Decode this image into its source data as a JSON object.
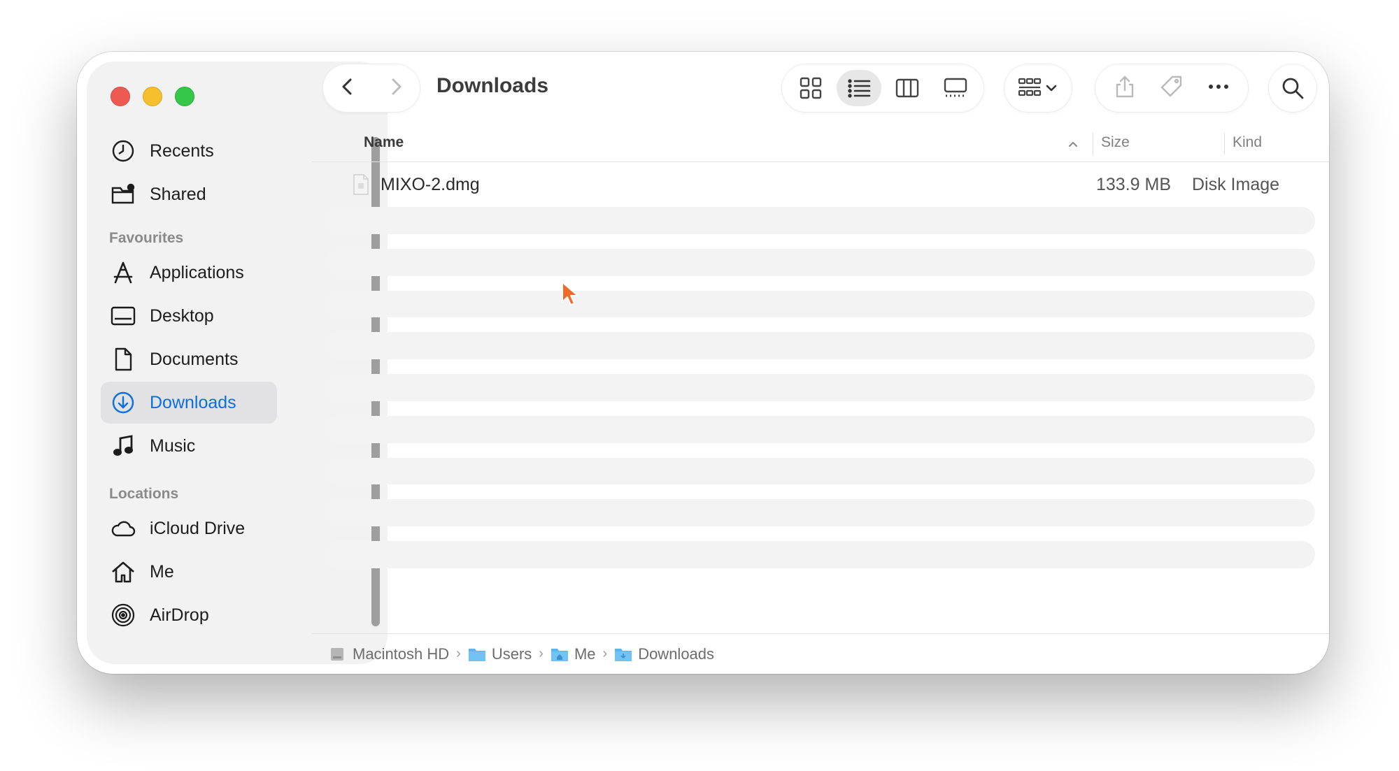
{
  "window": {
    "title": "Downloads"
  },
  "sidebar": {
    "top_items": [
      {
        "label": "Recents",
        "icon": "clock-icon"
      },
      {
        "label": "Shared",
        "icon": "shared-folder-icon"
      }
    ],
    "favourites_title": "Favourites",
    "favourites": [
      {
        "label": "Applications",
        "icon": "applications-icon"
      },
      {
        "label": "Desktop",
        "icon": "desktop-icon"
      },
      {
        "label": "Documents",
        "icon": "document-icon"
      },
      {
        "label": "Downloads",
        "icon": "download-icon",
        "active": true
      },
      {
        "label": "Music",
        "icon": "music-icon"
      }
    ],
    "locations_title": "Locations",
    "locations": [
      {
        "label": "iCloud Drive",
        "icon": "cloud-icon"
      },
      {
        "label": "Me",
        "icon": "home-icon"
      },
      {
        "label": "AirDrop",
        "icon": "airdrop-icon"
      }
    ]
  },
  "columns": {
    "name": "Name",
    "size": "Size",
    "kind": "Kind"
  },
  "files": [
    {
      "name": "MIXO-2.dmg",
      "size": "133.9 MB",
      "kind": "Disk Image"
    }
  ],
  "pathbar": {
    "items": [
      "Macintosh HD",
      "Users",
      "Me",
      "Downloads"
    ],
    "separator": "›"
  },
  "colors": {
    "accent": "#0a6fe0",
    "close": "#ee5a52",
    "minimize": "#f5bf2e",
    "maximize": "#34c748",
    "cursor": "#f06a2a"
  }
}
